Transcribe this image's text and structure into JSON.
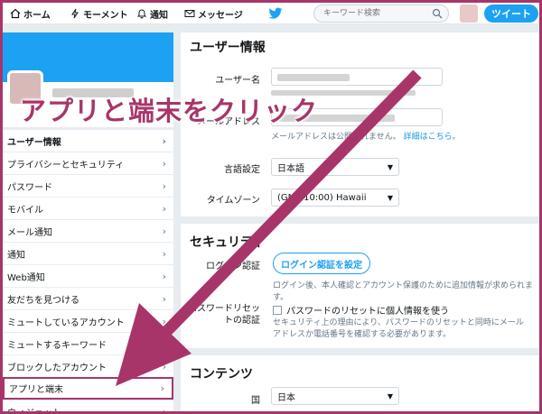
{
  "nav": {
    "home": "ホーム",
    "moments": "モーメント",
    "notifications": "通知",
    "messages": "メッセージ",
    "search_placeholder": "キーワード検索",
    "tweet_button": "ツイート"
  },
  "sidebar": {
    "items": [
      {
        "label": "ユーザー情報"
      },
      {
        "label": "プライバシーとセキュリティ"
      },
      {
        "label": "パスワード"
      },
      {
        "label": "モバイル"
      },
      {
        "label": "メール通知"
      },
      {
        "label": "通知"
      },
      {
        "label": "Web通知"
      },
      {
        "label": "友だちを見つける"
      },
      {
        "label": "ミュートしているアカウント"
      },
      {
        "label": "ミュートするキーワード"
      },
      {
        "label": "ブロックしたアカウント"
      },
      {
        "label": "アプリと端末"
      },
      {
        "label": "ウィジェット"
      }
    ]
  },
  "account": {
    "title": "ユーザー情報",
    "username_label": "ユーザー名",
    "email_label": "メールアドレス",
    "email_hint": "メールアドレスは公開されません。",
    "email_hint_link": "詳細はこちら。",
    "language_label": "言語設定",
    "language_value": "日本語",
    "timezone_label": "タイムゾーン",
    "timezone_value": "(GMT-10:00) Hawaii"
  },
  "security": {
    "title": "セキュリティ",
    "login_verification_label": "ログイン認証",
    "login_verification_button": "ログイン認証を設定",
    "login_verification_hint": "ログイン後、本人確認とアカウント保護のために追加情報が求められます。",
    "password_reset_label": "パスワードリセットの認証",
    "password_reset_checkbox": "パスワードのリセットに個人情報を使う",
    "password_reset_hint": "セキュリティ上の理由により、パスワードのリセットと同時にメールアドレスか電話番号を確認する必要があります。"
  },
  "content": {
    "title": "コンテンツ",
    "country_label": "国",
    "country_value": "日本"
  },
  "annotation": {
    "callout": "アプリと端末をクリック"
  },
  "colors": {
    "accent": "#1da1f2",
    "annotation": "#a8356a"
  }
}
